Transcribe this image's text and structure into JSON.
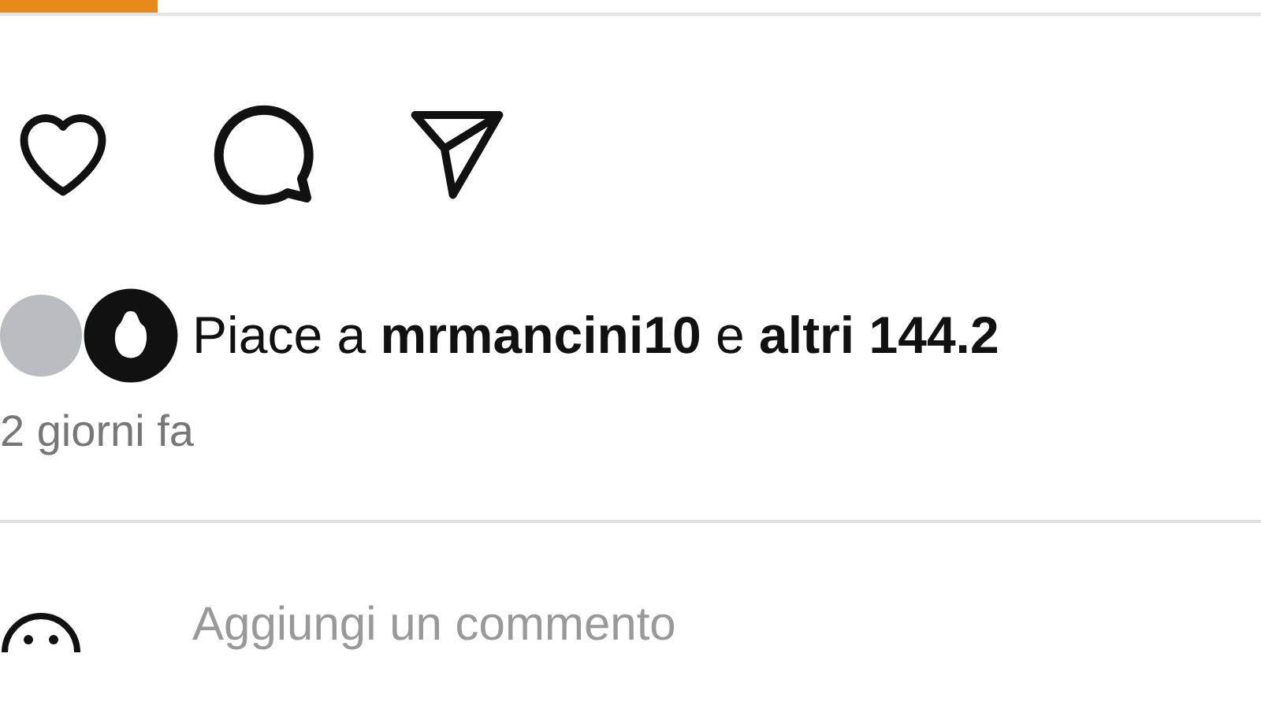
{
  "actions": [
    {
      "kind": "like"
    },
    {
      "kind": "comment"
    },
    {
      "kind": "share"
    }
  ],
  "likes": {
    "text": "Piace a **mrmancini10** e **altri 144.2**"
  },
  "time": "2 giorni fa",
  "comment": {
    "placeholder": "Aggiungi un commento"
  }
}
